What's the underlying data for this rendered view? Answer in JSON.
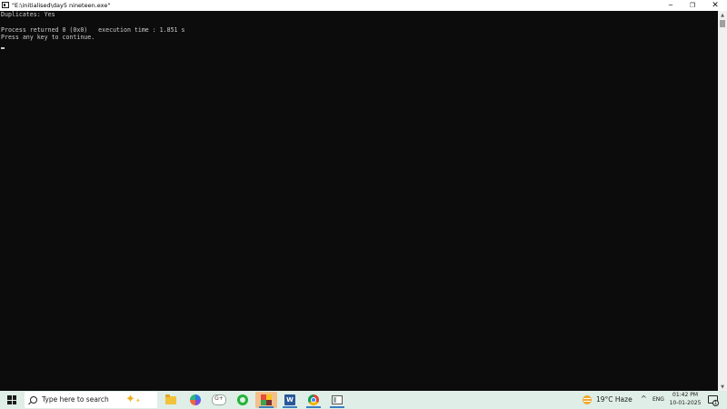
{
  "window": {
    "title": "\"E:\\initialised\\day5 nineteen.exe\"",
    "controls": {
      "minimize": "─",
      "maximize": "❐",
      "close": "✕"
    }
  },
  "console": {
    "lines": [
      "Duplicates: Yes",
      "",
      "Process returned 0 (0x0)   execution time : 1.851 s",
      "Press any key to continue."
    ],
    "text_color": "#cccccc",
    "background": "#0c0c0c"
  },
  "scrollbar": {
    "up_arrow": "▲",
    "down_arrow": "▼"
  },
  "taskbar": {
    "search_placeholder": "Type here to search",
    "pinned": [
      {
        "name": "file-explorer-icon"
      },
      {
        "name": "copilot-icon"
      },
      {
        "name": "chat-icon",
        "glyph": "G+"
      },
      {
        "name": "whatsapp-icon"
      },
      {
        "name": "codeblocks-icon",
        "active": true
      },
      {
        "name": "word-icon",
        "glyph": "W"
      },
      {
        "name": "chrome-icon"
      },
      {
        "name": "console-icon"
      }
    ],
    "weather": "19°C  Haze",
    "chevron": "^",
    "language": "ENG",
    "time": "01:42 PM",
    "date": "10-01-2025",
    "notification_count": "1"
  },
  "colors": {
    "taskbar_bg": "#dfeee6",
    "accent": "#3b7fc4"
  }
}
